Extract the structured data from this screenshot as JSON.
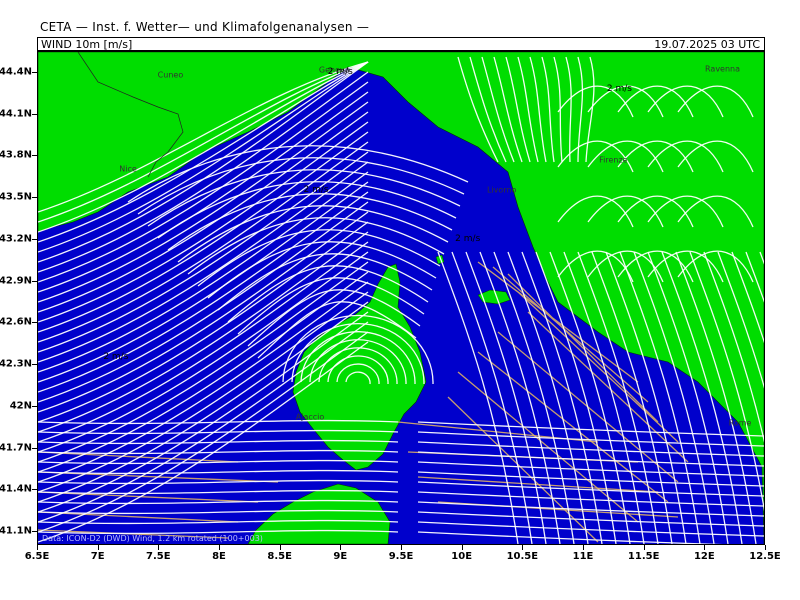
{
  "header": {
    "title": "CETA — Inst. f. Wetter— und Klimafolgenanalysen —",
    "field_label": "WIND 10m [m/s]",
    "datetime": "19.07.2025 03 UTC"
  },
  "axes": {
    "y_ticks": [
      "44.4N",
      "44.1N",
      "43.8N",
      "43.5N",
      "43.2N",
      "42.9N",
      "42.6N",
      "42.3N",
      "42N",
      "41.7N",
      "41.4N",
      "41.1N"
    ],
    "x_ticks": [
      "6.5E",
      "7E",
      "7.5E",
      "8E",
      "8.5E",
      "9E",
      "9.5E",
      "10E",
      "10.5E",
      "11E",
      "11.5E",
      "12E",
      "12.5E"
    ],
    "lon_range": [
      6.5,
      12.5
    ],
    "lat_range": [
      41.0,
      44.55
    ]
  },
  "cities": [
    {
      "name": "Cuneo",
      "lon": 7.6,
      "lat": 44.38
    },
    {
      "name": "Nice",
      "lon": 7.25,
      "lat": 43.7
    },
    {
      "name": "Genova",
      "lon": 8.95,
      "lat": 44.41
    },
    {
      "name": "Ravenna",
      "lon": 12.15,
      "lat": 44.42
    },
    {
      "name": "Firenze",
      "lon": 11.25,
      "lat": 43.77
    },
    {
      "name": "Livorno",
      "lon": 10.33,
      "lat": 43.55
    },
    {
      "name": "Ajaccio",
      "lon": 8.75,
      "lat": 41.92
    },
    {
      "name": "Rome",
      "lon": 12.4,
      "lat": 41.88
    }
  ],
  "wind_labels": [
    {
      "text": "2 m/s",
      "lon": 9.0,
      "lat": 44.4
    },
    {
      "text": "2 m/s",
      "lon": 11.3,
      "lat": 44.28
    },
    {
      "text": "2 m/s",
      "lon": 8.8,
      "lat": 43.55
    },
    {
      "text": "2 m/s",
      "lon": 10.05,
      "lat": 43.2
    },
    {
      "text": "2 m/s",
      "lon": 7.15,
      "lat": 42.35
    }
  ],
  "footer_note": "Data: ICON-D2 (DWD) Wind, 1.2 km rotated (100+003)",
  "colors": {
    "sea": "#0000cc",
    "land": "#00dd00",
    "streamline": "#ffffff",
    "stronger_wind": "#e8b860"
  }
}
